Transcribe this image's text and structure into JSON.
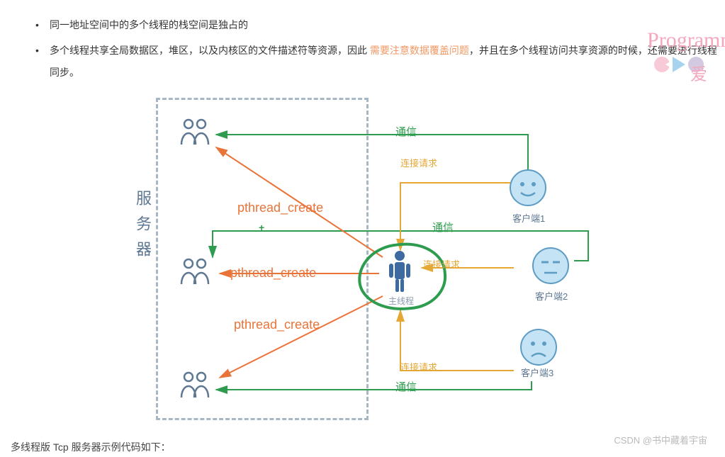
{
  "bullets": {
    "item1": "同一地址空间中的多个线程的栈空间是独占的",
    "item2_before": "多个线程共享全局数据区，堆区，以及内核区的文件描述符等资源，因此 ",
    "item2_highlight": "需要注意数据覆盖问题",
    "item2_after": "，并且在多个线程访问共享资源的时候，还需要进行线程同步。"
  },
  "watermark": {
    "text": "Programme",
    "ai": "爱"
  },
  "diagram": {
    "server_label": "服务器",
    "main_thread": "主线程",
    "pthread1": "pthread_create",
    "pthread2": "pthread_create",
    "pthread3": "pthread_create",
    "comm1": "通信",
    "comm2": "通信",
    "comm3": "通信",
    "req1": "连接请求",
    "req2": "连接请求",
    "req3": "连接请求",
    "client1": "客户端1",
    "client2": "客户端2",
    "client3": "客户端3"
  },
  "footer": {
    "text1": "多线程版 Tcp 服务器示例代码如下：",
    "text2": "CSDN @书中藏着宇宙"
  },
  "colors": {
    "orange": "#e97439",
    "green": "#2e9c4f",
    "yellow": "#e5a735",
    "blue": "#5e7793"
  }
}
